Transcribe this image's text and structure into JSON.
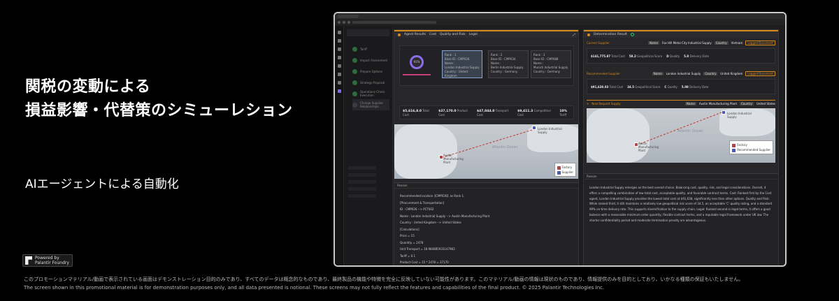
{
  "headline": {
    "line1": "関税の変動による",
    "line2": "損益影響・代替策のシミューレション"
  },
  "subheadline": "AIエージェントによる自動化",
  "badge": {
    "line1": "Powered by",
    "line2": "Palantir Foundry"
  },
  "disclaimer": {
    "jp": "このプロモーションマテリアル/動画で表示されている画面はデモンストレーション目的のみであり、すべてのデータは概念的なものであり、最終製品の機能や特徴を完全に反映していない可能性があります。このマテリアル/動画の情報は現状のものであり、情報提供のみを目的としており、いかなる種類の保証もいたしません。",
    "en": "The screen shown in this promotional material is for demonstration purposes only, and all data presented is notional.  These screens may not fully reflect the features and capabilities of the final product. © 2025 Palantir Technologies Inc."
  },
  "app": {
    "steps": [
      "Tariff",
      "Impact Assessment",
      "Prepare Options",
      "Strategy Proposal",
      "Operations Check Execution",
      "Change Supplier Relationships"
    ],
    "left_pane": {
      "title": "Agent Results",
      "tabs": [
        "Cost",
        "Quality and Risk",
        "Legal"
      ],
      "ring_label": "91%",
      "cards": [
        {
          "rank": "Rank : 1",
          "base_id": "Base ID : CMP026",
          "name_label": "Name :",
          "name": "London Industrial Supply",
          "country": "Country : United Kingdom"
        },
        {
          "rank": "Rank : 2",
          "base_id": "Base ID : CMP034",
          "name_label": "Name :",
          "name": "Berlin Industrial Supply",
          "country": "Country : Germany"
        },
        {
          "rank": "Rank : 3",
          "base_id": "Base ID : CMP088",
          "name_label": "Name :",
          "name": "Munich Industrial Supply",
          "country": "Country : Germany"
        }
      ],
      "kpis": [
        {
          "value": "$5,616,8.0",
          "label": "Total Cost"
        },
        {
          "value": "$37,170.0",
          "label": "Product Cost"
        },
        {
          "value": "$47,044.0",
          "label": "Transport Cost"
        },
        {
          "value": "$9,411.3",
          "label": "Competitive Cost"
        },
        {
          "value": "10%",
          "label": "Tariff"
        }
      ],
      "map": {
        "ocean_label": "Atlantic Ocean",
        "factory_label": "Austin Manufacturing Plant",
        "supplier_label": "London Industrial Supply",
        "legend": [
          "Factory",
          "Supplier"
        ]
      },
      "reason_title": "Reason",
      "reason_lines": [
        "Recommended location【CMP026】as Rank 1.",
        "[Procurement & Transportation]",
        "ID : CMP026 --> PCT002",
        "Name : London Industrial Supply --> Austin Manufacturing Plant",
        "Country : United Kingdom --> United States",
        "[Calculations]",
        "Price = 15",
        "Quantity = 2478",
        "Unit Transport = 18.984885933147983",
        "Tariff = 0.1",
        "Product Cost = 15 * 2478 = 37170"
      ]
    },
    "right_pane": {
      "title": "Determination Result",
      "current_supplier": {
        "label": "Current Supplier",
        "name_tag": "Name",
        "name": "Fox Hill Metal City Industrial Supply",
        "country_tag": "Country",
        "country": "Vietnam",
        "button": "Logged Document",
        "kpis": [
          {
            "value": "$141,775.87",
            "label": "Total Cost"
          },
          {
            "value": "58.2",
            "label": "Geopolitical Score"
          },
          {
            "value": "D",
            "label": "Quality"
          },
          {
            "value": "5.8",
            "label": "Delivery Date"
          }
        ]
      },
      "recommended_supplier": {
        "label": "Recommended Supplier",
        "name_tag": "Name",
        "name": "London Industrial Supply",
        "country_tag": "Country",
        "country": "United Kingdom",
        "button": "Logged Document",
        "kpis": [
          {
            "value": "$91,638.03",
            "label": "Total Cost"
          },
          {
            "value": "34.5",
            "label": "Geopolitical Score"
          },
          {
            "value": "C",
            "label": "Quality"
          },
          {
            "value": "5.08",
            "label": "Delivery Date"
          }
        ]
      },
      "new_request": {
        "label": "New Request Supply",
        "name_tag": "Name",
        "name": "Austin Manufacturing Plant",
        "country_tag": "Country",
        "country": "United States"
      },
      "map": {
        "ocean_label": "Atlantic Ocean",
        "factory_label": "Austin Manufacturing Plant",
        "supplier_label": "London Industrial Supply",
        "legend": [
          "Factory",
          "Recommended Supplier"
        ]
      },
      "reason_title": "Reason",
      "reason_text": "London Industrial Supply emerges as the best overall choice. Balancing cost, quality, risk, and legal considerations. Overall, it offers a compelling combination of low total cost, acceptable quality, and favorable contract terms. Cost: Ranked first by the Cost agent, London Industrial Supply provides the lowest total cost at $91,638, significantly less than other options. Quality and Risk: While ranked third, it still maintains a relatively low geopolitical risk score of 34.5, an acceptable 'C' quality rating, and a standard 99% on-time delivery rate. This supports diversification to the supply chain. Legal: Ranked second in legal terms, it offers a good balance with a reasonable minimum order quantity, flexible contract terms, and a reputable legal framework under UK law. The shorter confidentiality period and moderate termination penalty are advantageous."
    }
  }
}
